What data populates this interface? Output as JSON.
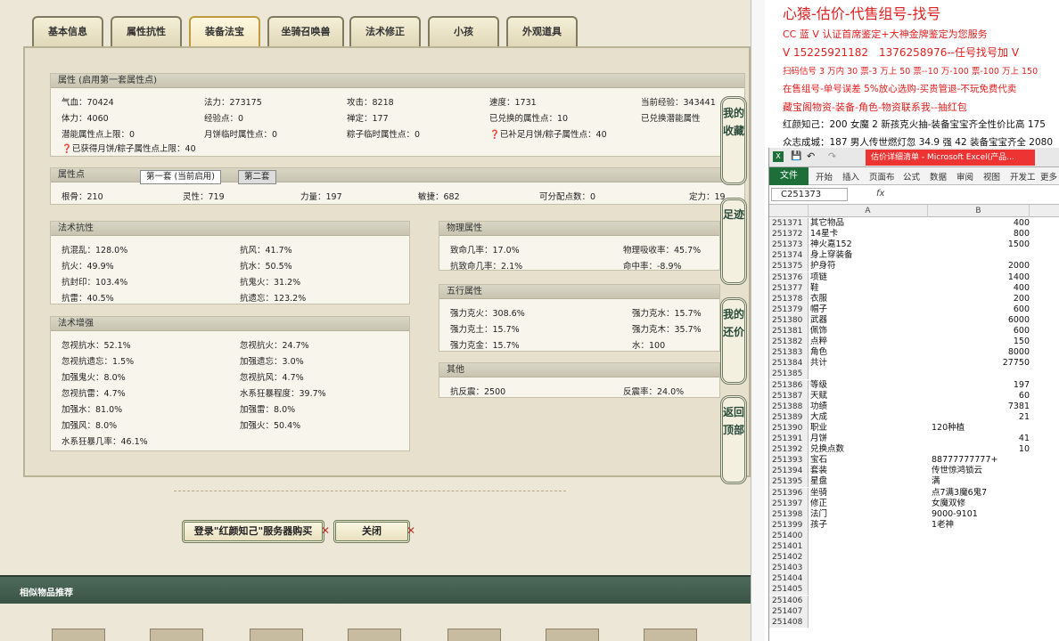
{
  "tabs": [
    "基本信息",
    "属性抗性",
    "装备法宝",
    "坐骑召唤兽",
    "法术修正",
    "小孩",
    "外观道具"
  ],
  "attr_panel": {
    "title": "属性 (启用第一套属性点)",
    "rows": [
      [
        "气血：70424",
        "法力：273175",
        "攻击：8218",
        "速度：1731",
        "当前经验：343441"
      ],
      [
        "体力：4060",
        "经验点：0",
        "禅定：177",
        "已兑换的属性点：10",
        "已兑换潜能属性"
      ],
      [
        "潜能属性点上限：0",
        "月饼临时属性点：0",
        "粽子临时属性点：0",
        "已补足月饼/粽子属性点：40",
        ""
      ]
    ],
    "note": "已获得月饼/粽子属性点上限：40"
  },
  "points_panel": {
    "title": "属性点",
    "subtab1": "第一套 (当前启用)",
    "subtab2": "第二套",
    "values": [
      "根骨：210",
      "灵性：719",
      "力量：197",
      "敏捷：682",
      "可分配点数：0",
      "定力：19"
    ]
  },
  "resist_panel": {
    "title": "法术抗性",
    "items": [
      "抗混乱：128.0%",
      "抗风：41.7%",
      "抗火：49.9%",
      "抗水：50.5%",
      "抗封印：103.4%",
      "抗鬼火：31.2%",
      "抗雷：40.5%",
      "抗遗忘：123.2%"
    ]
  },
  "enhance_panel": {
    "title": "法术增强",
    "items": [
      "忽视抗水：52.1%",
      "忽视抗火：24.7%",
      "忽视抗遗忘：1.5%",
      "加强遗忘：3.0%",
      "加强鬼火：8.0%",
      "忽视抗风：4.7%",
      "忽视抗雷：4.7%",
      "水系狂暴程度：39.7%",
      "加强水：81.0%",
      "加强雷：8.0%",
      "加强风：8.0%",
      "加强火：50.4%",
      "水系狂暴几率：46.1%",
      ""
    ]
  },
  "physical_panel": {
    "title": "物理属性",
    "items": [
      "致命几率：17.0%",
      "物理吸收率：45.7%",
      "抗致命几率：2.1%",
      "命中率：-8.9%"
    ]
  },
  "five_panel": {
    "title": "五行属性",
    "items": [
      "强力克火：308.6%",
      "强力克水：15.7%",
      "强力克土：15.7%",
      "强力克木：35.7%",
      "强力克金：15.7%",
      "水：100"
    ]
  },
  "other_panel": {
    "title": "其他",
    "items": [
      "抗反震：2500",
      "反震率：24.0%"
    ]
  },
  "side_buttons": [
    "我的收藏",
    "足迹",
    "我的还价",
    "返回顶部"
  ],
  "buttons": {
    "login": "登录\"红颜知己\"服务器购买",
    "close": "关闭"
  },
  "similar_title": "相似物品推荐",
  "ads": [
    {
      "text": "心猿-估价-代售组号-找号",
      "size": 16
    },
    {
      "text": "CC 蓝 V 认证首席鉴定+大神金牌鉴定为您服务",
      "size": 11
    },
    {
      "text": "V 15225921182　1376258976--任号找号加 V",
      "size": 12
    },
    {
      "text": "扫码估号 3 万内 30 票-3 万上 50 票--10 万-100 票-100 万上 150",
      "size": 9.5
    },
    {
      "text": "在售组号-单号误差 5%放心选购-买贵管退-不玩免费代卖",
      "size": 10.5
    },
    {
      "text": "藏宝阁物资-装备-角色-物资联系我--抽红包",
      "size": 11
    }
  ],
  "ads_black": [
    {
      "text": "红颜知己：200 女魔 2 新孩克火抽-装备宝宝齐全性价比高 175"
    },
    {
      "text": "众志成城：187 男人传世燃灯忽 34.9 强 42 装备宝宝齐全 2080"
    }
  ],
  "excel": {
    "title": "估价详细清单 - Microsoft Excel(产品...",
    "ribbon": [
      "文件",
      "开始",
      "插入",
      "页面布",
      "公式",
      "数据",
      "审阅",
      "视图",
      "开发工",
      "更多"
    ],
    "namebox": "C251373",
    "fx": "fx",
    "col_a": "A",
    "col_b": "B",
    "rows": [
      {
        "n": "251371",
        "a": "其它物品",
        "b": "400",
        "t": "num"
      },
      {
        "n": "251372",
        "a": "14星卡",
        "b": "800",
        "t": "num"
      },
      {
        "n": "251373",
        "a": "神火嘉152",
        "b": "1500",
        "t": "num"
      },
      {
        "n": "251374",
        "a": "身上穿装备",
        "b": "",
        "t": "num"
      },
      {
        "n": "251375",
        "a": "护身符",
        "b": "2000",
        "t": "num"
      },
      {
        "n": "251376",
        "a": "项链",
        "b": "1400",
        "t": "num"
      },
      {
        "n": "251377",
        "a": "鞋",
        "b": "400",
        "t": "num"
      },
      {
        "n": "251378",
        "a": "衣服",
        "b": "200",
        "t": "num"
      },
      {
        "n": "251379",
        "a": "帽子",
        "b": "600",
        "t": "num"
      },
      {
        "n": "251380",
        "a": "武器",
        "b": "6000",
        "t": "num"
      },
      {
        "n": "251381",
        "a": "佩饰",
        "b": "600",
        "t": "num"
      },
      {
        "n": "251382",
        "a": "点粹",
        "b": "150",
        "t": "num"
      },
      {
        "n": "251383",
        "a": "角色",
        "b": "8000",
        "t": "num"
      },
      {
        "n": "251384",
        "a": "共计",
        "b": "27750",
        "t": "num"
      },
      {
        "n": "251385",
        "a": "",
        "b": "",
        "t": "num"
      },
      {
        "n": "251386",
        "a": "等级",
        "b": "197",
        "t": "num"
      },
      {
        "n": "251387",
        "a": "天赋",
        "b": "60",
        "t": "num"
      },
      {
        "n": "251388",
        "a": "功绩",
        "b": "7381",
        "t": "num"
      },
      {
        "n": "251389",
        "a": "大成",
        "b": "21",
        "t": "num"
      },
      {
        "n": "251390",
        "a": "职业",
        "b": "120种植",
        "t": "txt"
      },
      {
        "n": "251391",
        "a": "月饼",
        "b": "41",
        "t": "num"
      },
      {
        "n": "251392",
        "a": "兑换点数",
        "b": "10",
        "t": "num"
      },
      {
        "n": "251393",
        "a": "宝石",
        "b": "88777777777+",
        "t": "txt"
      },
      {
        "n": "251394",
        "a": "套装",
        "b": "传世惊鸿锁云",
        "t": "txt"
      },
      {
        "n": "251395",
        "a": "星盘",
        "b": "满",
        "t": "txt"
      },
      {
        "n": "251396",
        "a": "坐骑",
        "b": "点7满3魔6鬼7",
        "t": "txt"
      },
      {
        "n": "251397",
        "a": "修正",
        "b": "女魔双修",
        "t": "txt"
      },
      {
        "n": "251398",
        "a": "法门",
        "b": "9000-9101",
        "t": "txt"
      },
      {
        "n": "251399",
        "a": "孩子",
        "b": "1老神",
        "t": "txt"
      },
      {
        "n": "251400",
        "a": "",
        "b": "",
        "t": "num"
      },
      {
        "n": "251401",
        "a": "",
        "b": "",
        "t": "num"
      },
      {
        "n": "251402",
        "a": "",
        "b": "",
        "t": "num"
      },
      {
        "n": "251403",
        "a": "",
        "b": "",
        "t": "num"
      },
      {
        "n": "251404",
        "a": "",
        "b": "",
        "t": "num"
      },
      {
        "n": "251405",
        "a": "",
        "b": "",
        "t": "num"
      },
      {
        "n": "251406",
        "a": "",
        "b": "",
        "t": "num"
      },
      {
        "n": "251407",
        "a": "",
        "b": "",
        "t": "num"
      },
      {
        "n": "251408",
        "a": "",
        "b": "",
        "t": "num"
      }
    ]
  }
}
